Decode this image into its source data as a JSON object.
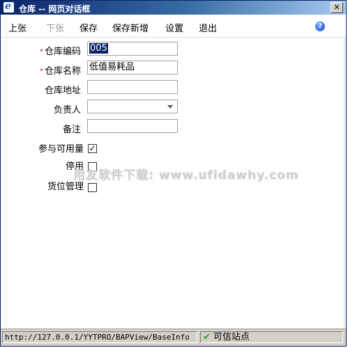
{
  "window": {
    "title": "仓库 -- 网页对话框",
    "close_label": "✕"
  },
  "menu": {
    "items": [
      {
        "label": "上张",
        "enabled": true
      },
      {
        "label": "下张",
        "enabled": false
      },
      {
        "label": "保存",
        "enabled": true
      },
      {
        "label": "保存新增",
        "enabled": true
      },
      {
        "label": "设置",
        "enabled": true
      },
      {
        "label": "退出",
        "enabled": true
      }
    ],
    "help_label": "?"
  },
  "form": {
    "required_mark": "*",
    "code_label": "仓库编码",
    "code_value": "005",
    "name_label": "仓库名称",
    "name_value": "低值易耗品",
    "address_label": "仓库地址",
    "manager_label": "负责人",
    "note_label": "备注",
    "available_label": "参与可用量",
    "available_checked": true,
    "disabled_label": "停用",
    "disabled_checked": false,
    "location_label": "货位管理",
    "location_checked": false
  },
  "watermark": "用友软件下载: www.ufidawhy.com",
  "status": {
    "url": "http://127.0.0.1/YYTPRO/BAPView/BaseInfo",
    "site": "可信站点"
  }
}
